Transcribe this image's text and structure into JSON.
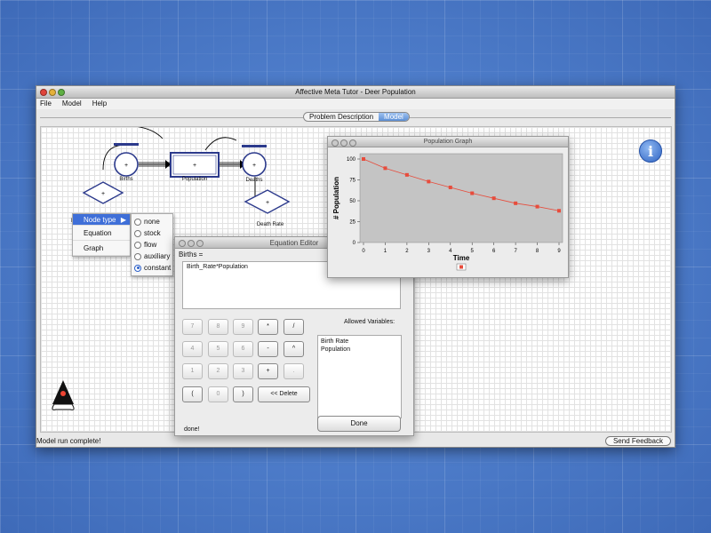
{
  "window": {
    "title": "Affective Meta Tutor - Deer Population"
  },
  "menubar": [
    "File",
    "Model",
    "Help"
  ],
  "tabs": [
    {
      "label": "Problem Description",
      "active": false
    },
    {
      "label": "Model",
      "active": true
    }
  ],
  "nodes": {
    "births": "Births",
    "population": "Population",
    "deaths": "Deaths",
    "death_rate": "Death Rate",
    "birth_rate_partial": "B"
  },
  "context_menu": {
    "items": [
      "Node type",
      "Equation",
      "Graph"
    ]
  },
  "node_type_submenu": {
    "options": [
      "none",
      "stock",
      "flow",
      "auxiliary",
      "constant"
    ],
    "selected": "constant"
  },
  "equation_editor": {
    "title": "Equation Editor",
    "label": "Births =",
    "equation": "Birth_Rate*Population",
    "allowed_label": "Allowed Variables:",
    "allowed_variables": [
      "Birth Rate",
      "Population"
    ],
    "keypad": [
      [
        "7",
        "8",
        "9",
        "*",
        "/"
      ],
      [
        "4",
        "5",
        "6",
        "-",
        "^"
      ],
      [
        "1",
        "2",
        "3",
        "+",
        "."
      ],
      [
        "(",
        "0",
        ")",
        "<< Delete"
      ]
    ],
    "done_button": "Done",
    "status": "done!"
  },
  "status_text": "Model run complete!",
  "feedback_button": "Send Feedback",
  "graph_window": {
    "title": "Population Graph"
  },
  "chart_data": {
    "type": "line",
    "title": "",
    "xlabel": "Time",
    "ylabel": "# Population",
    "x": [
      0,
      1,
      2,
      3,
      4,
      5,
      6,
      7,
      8,
      9
    ],
    "series": [
      {
        "values": [
          100,
          89,
          81,
          73,
          66,
          59,
          53,
          47,
          43,
          38
        ],
        "color": "#e74c3c"
      }
    ],
    "xlim": [
      0,
      9
    ],
    "ylim": [
      0,
      100
    ],
    "yticks": [
      0,
      25,
      50,
      75,
      100
    ],
    "grid": false,
    "plot_background": "#c4c4c4",
    "legend_position": "bottom-center"
  }
}
